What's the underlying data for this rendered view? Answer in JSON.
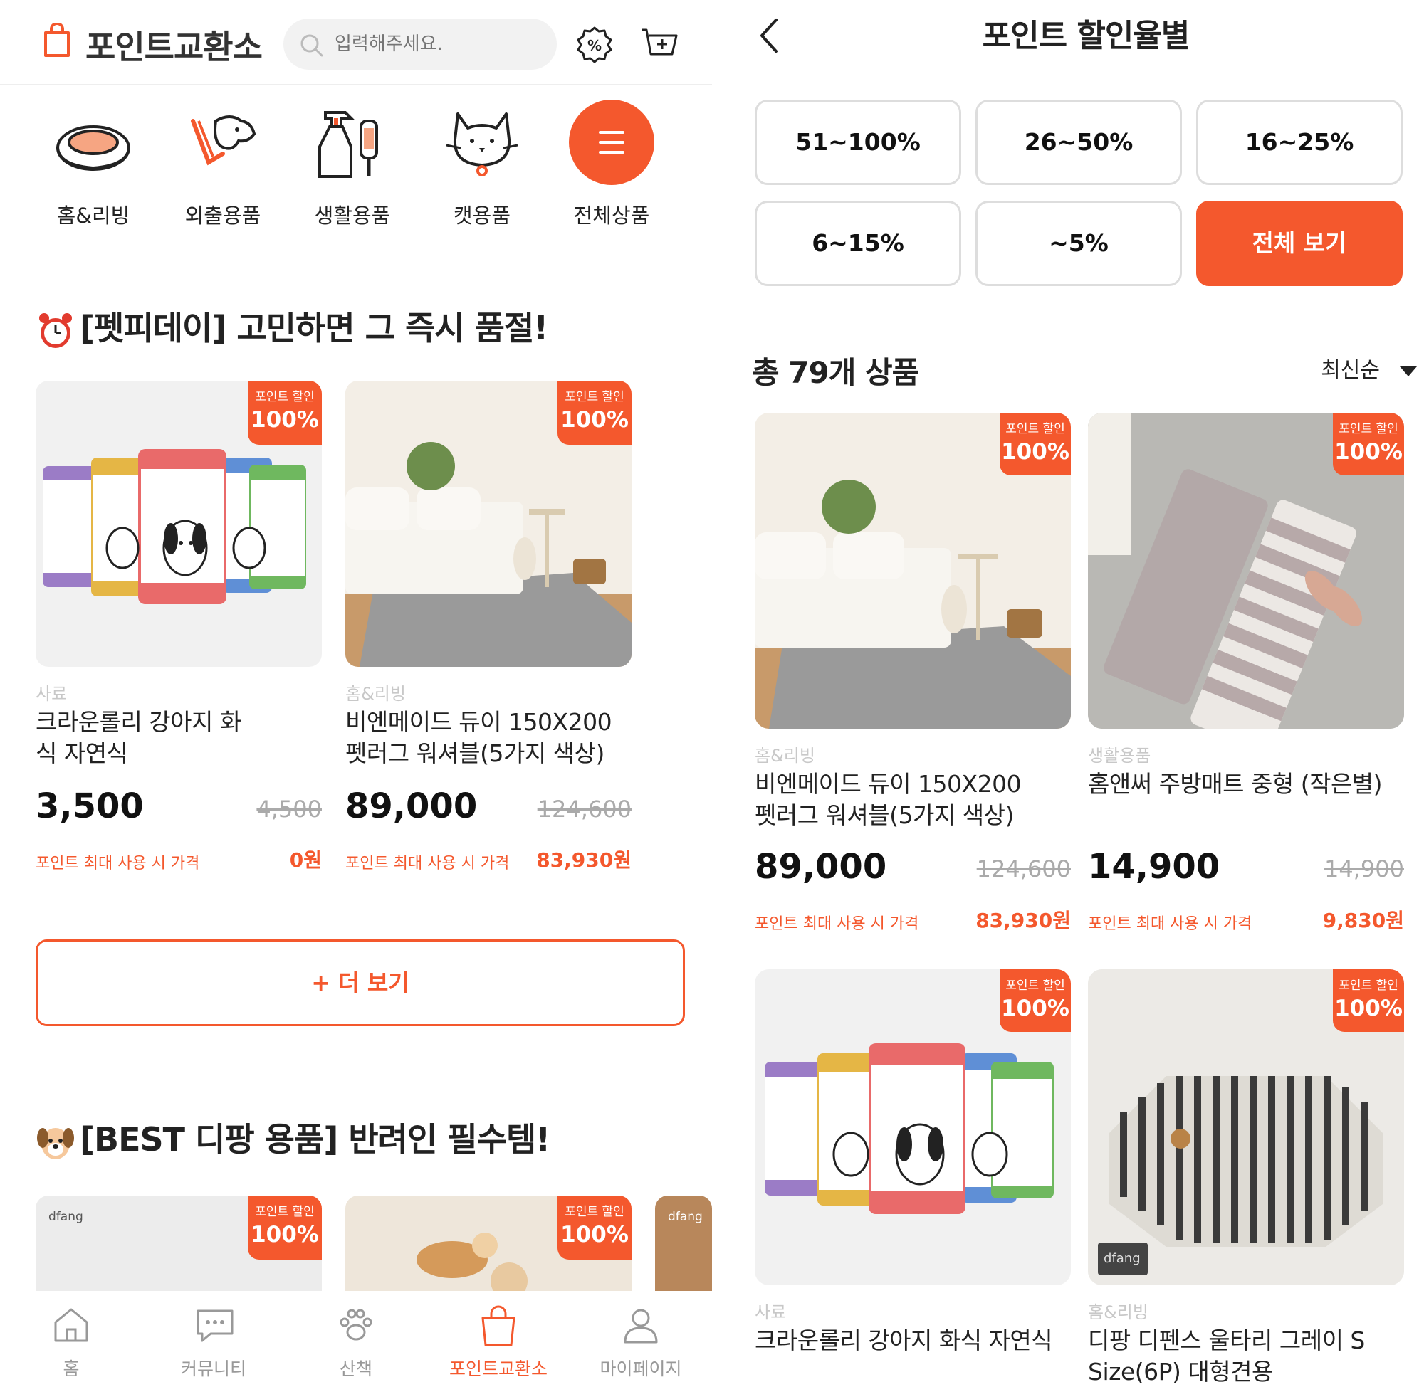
{
  "colors": {
    "accent": "#f4582d",
    "muted": "#c8c8c8",
    "border": "#dddddd"
  },
  "left": {
    "header": {
      "title": "포인트교환소",
      "search_placeholder": "입력해주세요.",
      "icons": [
        "shopping-bag-icon",
        "discount-badge-icon",
        "cart-plus-icon"
      ]
    },
    "categories": [
      {
        "label": "홈&리빙",
        "icon": "pet-bed-icon"
      },
      {
        "label": "외출용품",
        "icon": "dog-harness-icon"
      },
      {
        "label": "생활용품",
        "icon": "spray-bottle-icon"
      },
      {
        "label": "캣용품",
        "icon": "cat-face-icon"
      },
      {
        "label": "전체상품",
        "icon": "menu-icon"
      }
    ],
    "section1": {
      "title": "[펫피데이] 고민하면 그 즉시 품절!",
      "products": [
        {
          "tag_top": "포인트 할인",
          "tag_pct": "100%",
          "category": "사료",
          "name": "크라운롤리 강아지 화식 자연식",
          "price": "3,500",
          "original": "4,500",
          "point_label": "포인트 최대 사용 시 가격",
          "point_price": "0원"
        },
        {
          "tag_top": "포인트 할인",
          "tag_pct": "100%",
          "category": "홈&리빙",
          "name": "비엔메이드 듀이 150X200 펫러그 워셔블(5가지 색상)",
          "price": "89,000",
          "original": "124,600",
          "point_label": "포인트 최대 사용 시 가격",
          "point_price": "83,930원"
        }
      ],
      "more_label": "+ 더 보기"
    },
    "section2": {
      "title": "[BEST 디팡 용품] 반려인 필수템!",
      "brand": "dfang",
      "tags": [
        {
          "tag_top": "포인트 할인",
          "tag_pct": "100%"
        },
        {
          "tag_top": "포인트 할인",
          "tag_pct": "100%"
        }
      ]
    },
    "tabbar": [
      {
        "label": "홈",
        "icon": "home-icon"
      },
      {
        "label": "커뮤니티",
        "icon": "chat-icon"
      },
      {
        "label": "산책",
        "icon": "paw-icon"
      },
      {
        "label": "포인트교환소",
        "icon": "shopping-bag-icon",
        "active": true
      },
      {
        "label": "마이페이지",
        "icon": "user-icon"
      }
    ]
  },
  "right": {
    "header": {
      "title": "포인트 할인율별"
    },
    "filters": [
      "51~100%",
      "26~50%",
      "16~25%",
      "6~15%",
      "~5%",
      "전체 보기"
    ],
    "active_filter": "전체 보기",
    "count": "총 79개 상품",
    "sort": "최신순",
    "products": [
      {
        "tag_top": "포인트 할인",
        "tag_pct": "100%",
        "category": "홈&리빙",
        "name": "비엔메이드 듀이 150X200 펫러그 워셔블(5가지 색상)",
        "price": "89,000",
        "original": "124,600",
        "point_label": "포인트 최대 사용 시 가격",
        "point_price": "83,930원"
      },
      {
        "tag_top": "포인트 할인",
        "tag_pct": "100%",
        "category": "생활용품",
        "name": "홈앤써 주방매트 중형 (작은별)",
        "price": "14,900",
        "original": "14,900",
        "point_label": "포인트 최대 사용 시 가격",
        "point_price": "9,830원"
      },
      {
        "tag_top": "포인트 할인",
        "tag_pct": "100%",
        "category": "사료",
        "name": "크라운롤리 강아지 화식 자연식"
      },
      {
        "tag_top": "포인트 할인",
        "tag_pct": "100%",
        "category": "홈&리빙",
        "name": "디팡 디펜스 울타리 그레이 S Size(6P) 대형견용",
        "brand": "dfang"
      }
    ]
  }
}
